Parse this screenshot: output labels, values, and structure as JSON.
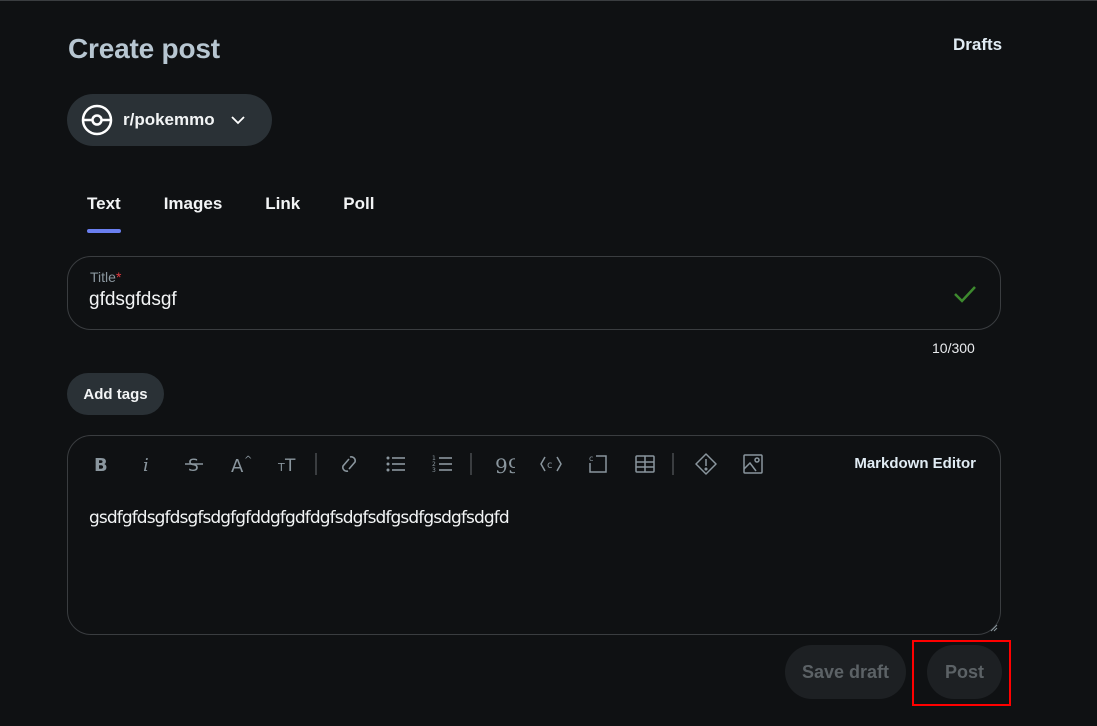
{
  "header": {
    "title": "Create post",
    "drafts_label": "Drafts"
  },
  "community": {
    "name": "r/pokemmo",
    "icon": "pokeball-icon"
  },
  "tabs": [
    {
      "label": "Text",
      "active": true
    },
    {
      "label": "Images",
      "active": false
    },
    {
      "label": "Link",
      "active": false
    },
    {
      "label": "Poll",
      "active": false
    }
  ],
  "title_field": {
    "label": "Title",
    "required_marker": "*",
    "value": "gfdsgfdsgf",
    "char_count": "10/300",
    "valid": true
  },
  "add_tags_label": "Add tags",
  "editor": {
    "toolbar": [
      {
        "name": "bold",
        "icon": "bold-icon"
      },
      {
        "name": "italic",
        "icon": "italic-icon"
      },
      {
        "name": "strikethrough",
        "icon": "strikethrough-icon"
      },
      {
        "name": "superscript",
        "icon": "superscript-icon"
      },
      {
        "name": "heading",
        "icon": "heading-icon"
      },
      {
        "name": "link",
        "icon": "link-icon"
      },
      {
        "name": "bulleted-list",
        "icon": "bullet-list-icon"
      },
      {
        "name": "numbered-list",
        "icon": "numbered-list-icon"
      },
      {
        "name": "quote",
        "icon": "quote-icon"
      },
      {
        "name": "code",
        "icon": "code-icon"
      },
      {
        "name": "code-block",
        "icon": "code-block-icon"
      },
      {
        "name": "table",
        "icon": "table-icon"
      },
      {
        "name": "spoiler",
        "icon": "spoiler-icon"
      },
      {
        "name": "image",
        "icon": "image-icon"
      }
    ],
    "mode_label": "Markdown Editor",
    "body": "gsdfgfdsgfdsgfsdgfgfddgfgdfdgfsdgfsdfgsdfgsdgfsdgfd"
  },
  "actions": {
    "save_draft_label": "Save draft",
    "post_label": "Post"
  },
  "colors": {
    "background": "#0f1113",
    "accent": "#6a7ff0",
    "valid": "#3d8a2e",
    "required": "#e0383e",
    "highlight": "#ff0000"
  }
}
